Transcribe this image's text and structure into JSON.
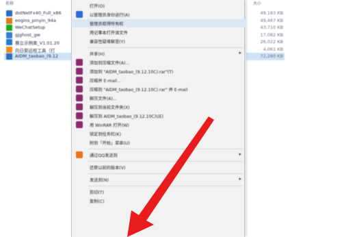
{
  "explorer": {
    "headers": {
      "name": "名称",
      "size": "大小"
    },
    "files": [
      {
        "name": "dotNetFx40_Full_x86",
        "size": "49,183 KB",
        "color": "#2b6cc4",
        "icon": "installer-icon"
      },
      {
        "name": "eogins_pinyin_94a",
        "size": "49,467 KB",
        "color": "#e07a1a",
        "icon": "installer-icon"
      },
      {
        "name": "WeChatSetup",
        "size": "43,710 KB",
        "color": "#1aad19",
        "icon": "wechat-icon"
      },
      {
        "name": "gjghost_gw",
        "size": "17,082 KB",
        "color": "#3a7bd5",
        "icon": "exe-icon"
      },
      {
        "name": "赛立示例类_V1.01.20",
        "size": "26,022 KB",
        "color": "#1a7fd4",
        "icon": "exe-icon"
      },
      {
        "name": "向日葵远程工具（打",
        "size": "4,061 KB",
        "color": "#f28b20",
        "icon": "exe-icon"
      },
      {
        "name": "AIDM_taobao_(9.12",
        "size": "72,280 KB",
        "color": "#2a6fb8",
        "icon": "exe-icon",
        "selected": true
      }
    ]
  },
  "context_menu": {
    "items": [
      {
        "label": "打开(O)",
        "icon": "",
        "arrow": ""
      },
      {
        "label": "以管理员身份运行(A)",
        "icon": "shield-icon",
        "color": "#2f6bd0",
        "arrow": ""
      },
      {
        "label": "管理员取得所有权",
        "icon": "",
        "arrow": "",
        "hover": true
      },
      {
        "label": "用记事本打开该文件",
        "icon": "",
        "arrow": ""
      },
      {
        "label": "兼容性疑难解答(Y)",
        "icon": "",
        "arrow": ""
      },
      {
        "sep": true
      },
      {
        "label": "共享(H)",
        "icon": "",
        "arrow": "▸"
      },
      {
        "label": "添加到压缩文件(A)...",
        "icon": "winrar-icon",
        "color": "#8b2a6e",
        "arrow": ""
      },
      {
        "label": "添加到 \"AIDM_taobao_(9.12.10C).rar\"(T)",
        "icon": "winrar-icon",
        "color": "#8b2a6e",
        "arrow": ""
      },
      {
        "label": "压缩并 E-mail...",
        "icon": "winrar-icon",
        "color": "#8b2a6e",
        "arrow": ""
      },
      {
        "label": "压缩到 \"AIDM_taobao_(9.12.10C).rar\" 并 E-mail",
        "icon": "winrar-icon",
        "color": "#8b2a6e",
        "arrow": ""
      },
      {
        "label": "解压文件(A)...",
        "icon": "winrar-icon",
        "color": "#8b2a6e",
        "arrow": ""
      },
      {
        "label": "解压到当前文件夹(X)",
        "icon": "winrar-icon",
        "color": "#8b2a6e",
        "arrow": ""
      },
      {
        "label": "解压到 AIDM_taobao_(9.12.10C)\\(E)",
        "icon": "winrar-icon",
        "color": "#8b2a6e",
        "arrow": ""
      },
      {
        "label": "用 WinRAR 打开(W)",
        "icon": "winrar-icon",
        "color": "#8b2a6e",
        "arrow": ""
      },
      {
        "label": "锁定到任务栏(K)",
        "icon": "",
        "arrow": ""
      },
      {
        "label": "附到「开始」菜单(U)",
        "icon": "",
        "arrow": ""
      },
      {
        "sep": true
      },
      {
        "label": "通过QQ发送到",
        "icon": "qq-icon",
        "color": "#e8731a",
        "arrow": "▸"
      },
      {
        "sep": true
      },
      {
        "label": "还原以前的版本(V)",
        "icon": "",
        "arrow": ""
      },
      {
        "sep": true
      },
      {
        "label": "发送到(N)",
        "icon": "",
        "arrow": "▸"
      },
      {
        "sep": true
      },
      {
        "label": "剪切(T)",
        "icon": "",
        "arrow": ""
      },
      {
        "label": "复制(C)",
        "icon": "",
        "arrow": ""
      }
    ]
  },
  "annotation": {
    "color": "#e81c1c"
  }
}
